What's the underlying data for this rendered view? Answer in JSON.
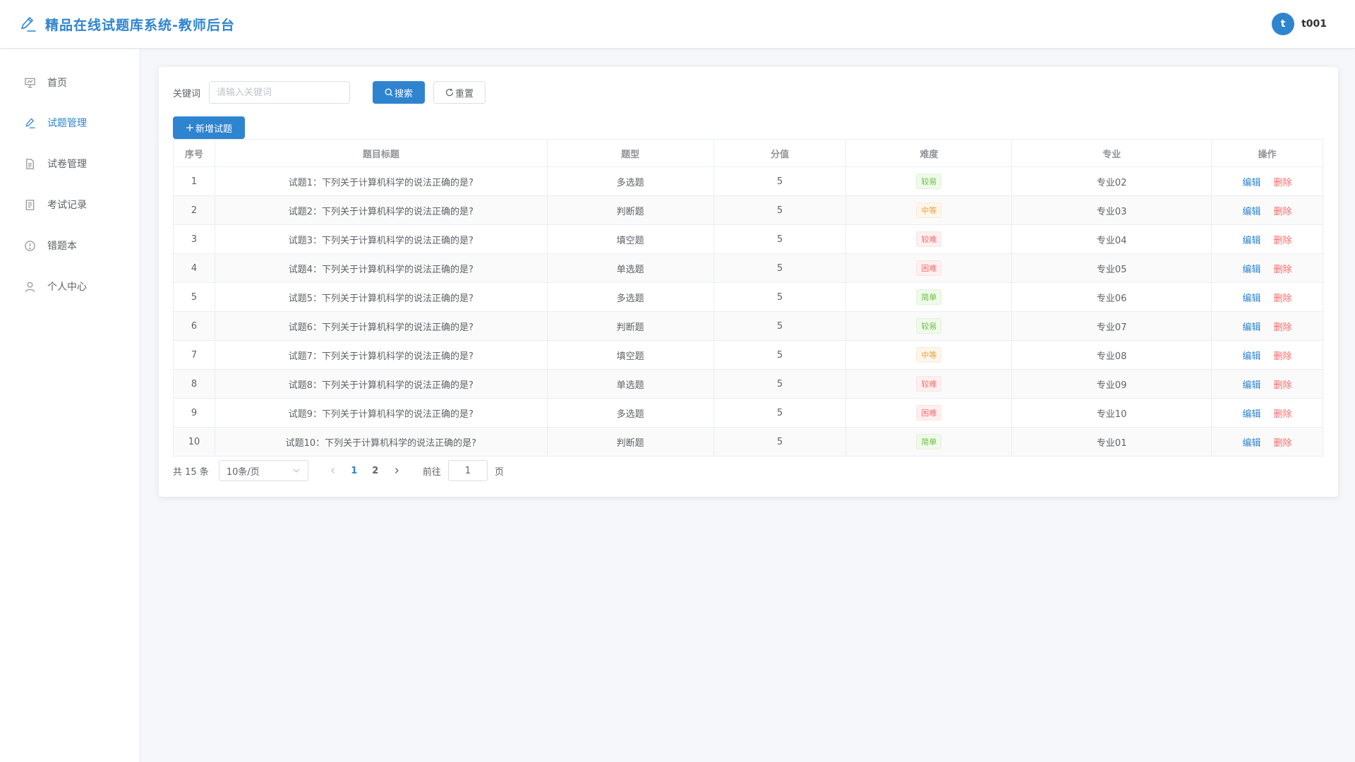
{
  "app": {
    "title": "精品在线试题库系统-教师后台",
    "logo_icon": "pencil-icon",
    "accent_color": "#2f84d0"
  },
  "user": {
    "avatar_letter": "t",
    "name": "t001"
  },
  "sidebar": {
    "items": [
      {
        "label": "首页",
        "icon": "presentation-icon",
        "active": false
      },
      {
        "label": "试题管理",
        "icon": "pencil-icon",
        "active": true
      },
      {
        "label": "试卷管理",
        "icon": "document-icon",
        "active": false
      },
      {
        "label": "考试记录",
        "icon": "list-icon",
        "active": false
      },
      {
        "label": "错题本",
        "icon": "info-icon",
        "active": false
      },
      {
        "label": "个人中心",
        "icon": "user-icon",
        "active": false
      }
    ]
  },
  "search": {
    "label": "关键词",
    "placeholder": "请输入关键词",
    "value": "",
    "search_button": "搜索",
    "reset_button": "重置"
  },
  "add_button": "新增试题",
  "table": {
    "headers": [
      "序号",
      "题目标题",
      "题型",
      "分值",
      "难度",
      "专业",
      "操作"
    ],
    "edit_label": "编辑",
    "delete_label": "删除",
    "rows": [
      {
        "index": "1",
        "title": "试题1：下列关于计算机科学的说法正确的是?",
        "type": "多选题",
        "score": "5",
        "difficulty": "较易",
        "level": "success",
        "major": "专业02"
      },
      {
        "index": "2",
        "title": "试题2：下列关于计算机科学的说法正确的是?",
        "type": "判断题",
        "score": "5",
        "difficulty": "中等",
        "level": "warning",
        "major": "专业03"
      },
      {
        "index": "3",
        "title": "试题3：下列关于计算机科学的说法正确的是?",
        "type": "填空题",
        "score": "5",
        "difficulty": "较难",
        "level": "danger",
        "major": "专业04"
      },
      {
        "index": "4",
        "title": "试题4：下列关于计算机科学的说法正确的是?",
        "type": "单选题",
        "score": "5",
        "difficulty": "困难",
        "level": "danger",
        "major": "专业05"
      },
      {
        "index": "5",
        "title": "试题5：下列关于计算机科学的说法正确的是?",
        "type": "多选题",
        "score": "5",
        "difficulty": "简单",
        "level": "success",
        "major": "专业06"
      },
      {
        "index": "6",
        "title": "试题6：下列关于计算机科学的说法正确的是?",
        "type": "判断题",
        "score": "5",
        "difficulty": "较易",
        "level": "success",
        "major": "专业07"
      },
      {
        "index": "7",
        "title": "试题7：下列关于计算机科学的说法正确的是?",
        "type": "填空题",
        "score": "5",
        "difficulty": "中等",
        "level": "warning",
        "major": "专业08"
      },
      {
        "index": "8",
        "title": "试题8：下列关于计算机科学的说法正确的是?",
        "type": "单选题",
        "score": "5",
        "difficulty": "较难",
        "level": "danger",
        "major": "专业09"
      },
      {
        "index": "9",
        "title": "试题9：下列关于计算机科学的说法正确的是?",
        "type": "多选题",
        "score": "5",
        "difficulty": "困难",
        "level": "danger",
        "major": "专业10"
      },
      {
        "index": "10",
        "title": "试题10：下列关于计算机科学的说法正确的是?",
        "type": "判断题",
        "score": "5",
        "difficulty": "简单",
        "level": "success",
        "major": "专业01"
      }
    ]
  },
  "tag_colors": {
    "success": {
      "text": "#67c23a",
      "bg": "#f0f9eb",
      "border": "#e1f3d8"
    },
    "warning": {
      "text": "#e6a23c",
      "bg": "#fdf6ec",
      "border": "#faecd8"
    },
    "danger": {
      "text": "#f56c6c",
      "bg": "#fef0f0",
      "border": "#fde2e2"
    }
  },
  "pagination": {
    "total_text": "共 15 条",
    "page_size": "10条/页",
    "pages": [
      "1",
      "2"
    ],
    "current_page": "1",
    "goto_label": "前往",
    "goto_value": "1",
    "page_suffix": "页"
  }
}
